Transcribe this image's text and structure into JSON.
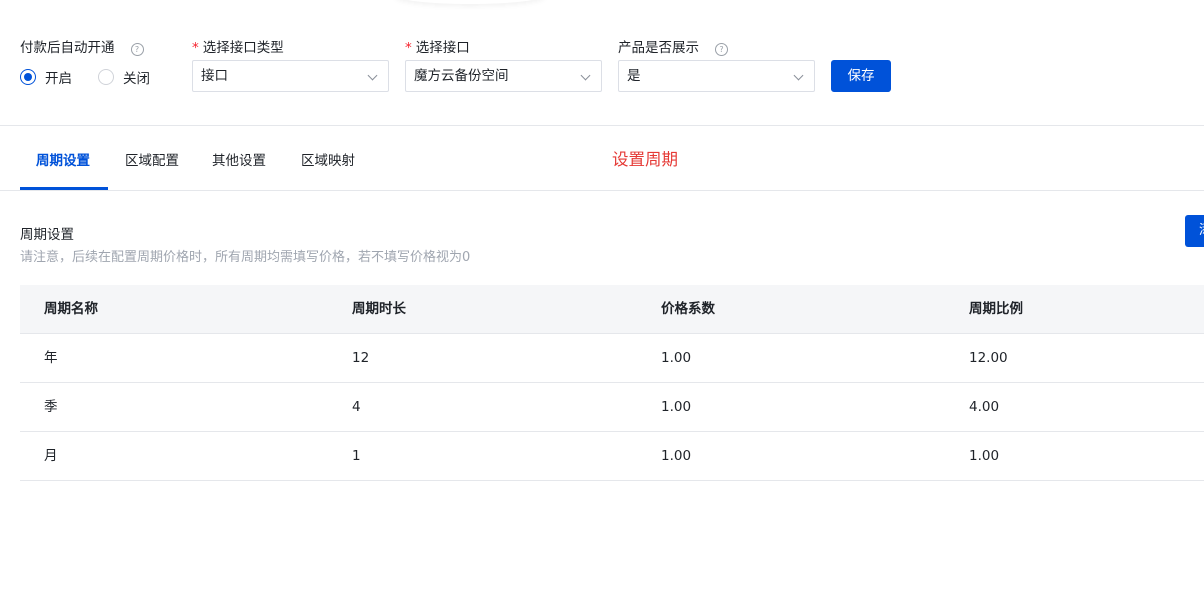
{
  "form": {
    "auto_open": {
      "label": "付款后自动开通",
      "help_icon": "?",
      "options": [
        "开启",
        "关闭"
      ],
      "selected": "开启"
    },
    "interface_type": {
      "required_mark": "*",
      "label": "选择接口类型",
      "value": "接口"
    },
    "interface": {
      "required_mark": "*",
      "label": "选择接口",
      "value": "魔方云备份空间"
    },
    "product_display": {
      "label": "产品是否展示",
      "help_icon": "?",
      "value": "是"
    },
    "save_label": "保存"
  },
  "tabs": [
    {
      "label": "周期设置",
      "active": true
    },
    {
      "label": "区域配置",
      "active": false
    },
    {
      "label": "其他设置",
      "active": false
    },
    {
      "label": "区域映射",
      "active": false
    }
  ],
  "annotation": "设置周期",
  "section": {
    "title": "周期设置",
    "note": "请注意，后续在配置周期价格时，所有周期均需填写价格，若不填写价格视为0",
    "partial_button_label": "添"
  },
  "table": {
    "headers": [
      "周期名称",
      "周期时长",
      "价格系数",
      "周期比例"
    ],
    "rows": [
      [
        "年",
        "12",
        "1.00",
        "12.00"
      ],
      [
        "季",
        "4",
        "1.00",
        "4.00"
      ],
      [
        "月",
        "1",
        "1.00",
        "1.00"
      ]
    ]
  },
  "colors": {
    "primary": "#0052d9",
    "required": "#f5222d",
    "annotation": "#e53935"
  },
  "icons": {
    "help": "help-circle-icon",
    "chevron": "chevron-down-icon",
    "radio": "radio-icon"
  }
}
